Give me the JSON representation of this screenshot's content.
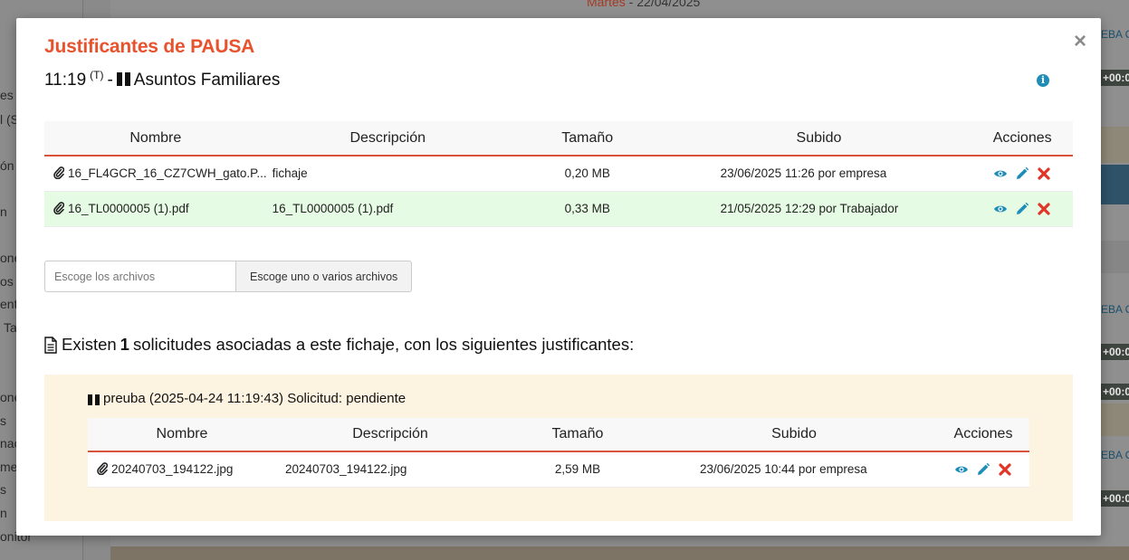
{
  "background": {
    "date_day": "Martes",
    "date_sep": " - ",
    "date_value": "22/04/2025",
    "sidebar_fragments": [
      "es",
      "l (S",
      "ón",
      "n",
      "one",
      "os",
      "ent",
      "Ta",
      "one",
      "s",
      "nac",
      "mes",
      "s",
      "n",
      "onitor"
    ],
    "right_labels": [
      "EBA C",
      "EBA C",
      "EBA C"
    ],
    "right_times": [
      "+00:0",
      "+00:0",
      "+00:0",
      "+00:0"
    ]
  },
  "modal": {
    "title": "Justificantes de PAUSA",
    "close_symbol": "×",
    "subtitle": {
      "time": "11:19",
      "sup": "(T)",
      "dash": "-",
      "reason": "Asuntos Familiares"
    },
    "info_symbol": "i",
    "table": {
      "headers": [
        "Nombre",
        "Descripción",
        "Tamaño",
        "Subido",
        "Acciones"
      ],
      "rows": [
        {
          "name": "16_FL4GCR_16_CZ7CWH_gato.P...",
          "desc": "fichaje",
          "size": "0,20 MB",
          "uploaded": "23/06/2025 11:26 por empresa",
          "highlight": false
        },
        {
          "name": "16_TL0000005 (1).pdf",
          "desc": "16_TL0000005 (1).pdf",
          "size": "0,33 MB",
          "uploaded": "21/05/2025 12:29 por Trabajador",
          "highlight": true
        }
      ]
    },
    "file_picker": {
      "placeholder": "Escoge los archivos",
      "button": "Escoge uno o varios archivos"
    },
    "existing": {
      "prefix": "Existen",
      "count": "1",
      "suffix": "solicitudes asociadas a este fichaje, con los siguientes justificantes:"
    },
    "request": {
      "title": "preuba (2025-04-24 11:19:43) Solicitud: pendiente",
      "table": {
        "headers": [
          "Nombre",
          "Descripción",
          "Tamaño",
          "Subido",
          "Acciones"
        ],
        "rows": [
          {
            "name": "20240703_194122.jpg",
            "desc": "20240703_194122.jpg",
            "size": "2,59 MB",
            "uploaded": "23/06/2025 10:44 por empresa"
          }
        ]
      }
    },
    "icons": {
      "view": "eye-icon",
      "edit": "pencil-icon",
      "delete": "x-icon",
      "attachment": "paperclip-icon",
      "document": "document-icon",
      "pause": "pause-icon",
      "info": "info-icon"
    },
    "colors": {
      "title": "#e8522d",
      "header_border": "#d9533a",
      "action_blue": "#1f8db8",
      "delete_red": "#e03527",
      "row_highlight": "#e6fbe4",
      "request_bg": "#fdf3e1"
    }
  }
}
